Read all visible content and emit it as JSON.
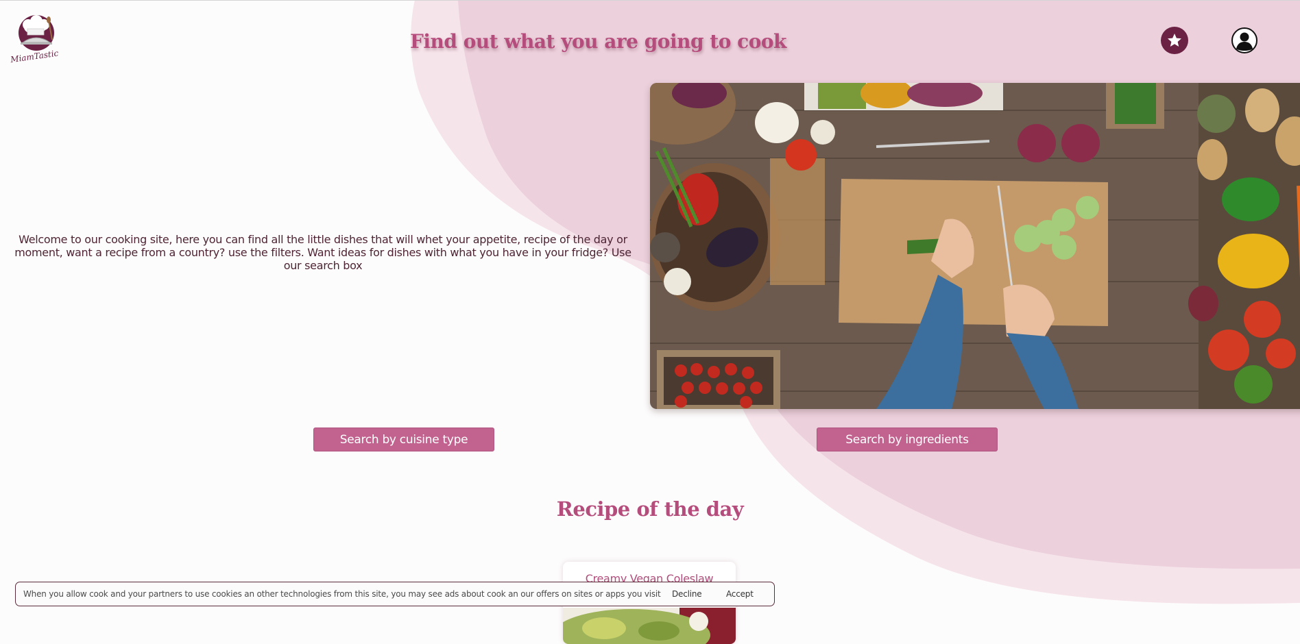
{
  "colors": {
    "accent": "#b54d7c",
    "button": "#c2628f",
    "blob_light": "#f5e1e9",
    "blob_mid": "#edd1dd",
    "dark_plum": "#6a2144"
  },
  "header": {
    "logo_alt": "logo",
    "logo_text": "MiamTastic",
    "headline": "Find out what you are going to cook",
    "favorites_icon": "star-icon",
    "account_icon": "user-icon"
  },
  "intro": {
    "text": "Welcome to our cooking site, here you can find all the little dishes that will whet your appetite, recipe of the day or moment, want a recipe from a country? use the filters. Want ideas for dishes with what you have in your fridge? Use our search box"
  },
  "actions": {
    "cuisine_label": "Search by cuisine type",
    "ingredients_label": "Search by ingredients"
  },
  "recipe_of_day": {
    "heading": "Recipe of the day",
    "title": "Creamy Vegan Coleslaw Dressed"
  },
  "cookie_banner": {
    "text": "When you allow cook and your partners to use cookies an other technologies from this site, you may see ads about cook an our offers on sites or apps you visit",
    "decline_label": "Decline",
    "accept_label": "Accept"
  }
}
